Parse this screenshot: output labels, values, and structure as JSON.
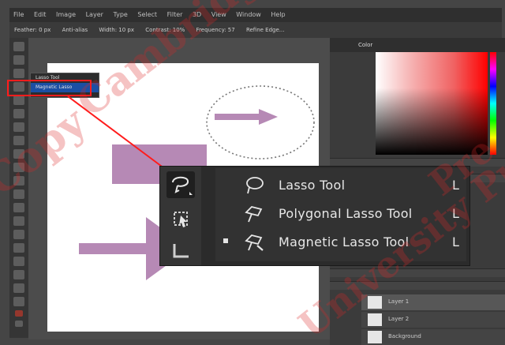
{
  "menubar": [
    "File",
    "Edit",
    "Image",
    "Layer",
    "Type",
    "Select",
    "Filter",
    "3D",
    "View",
    "Window",
    "Help"
  ],
  "options": [
    "Feather: 0 px",
    "Anti-alias",
    "Width: 10 px",
    "Contrast: 10%",
    "Frequency: 57",
    "Refine Edge..."
  ],
  "small_flyout": {
    "items": [
      "Lasso Tool",
      "Magnetic Lasso"
    ],
    "selected_index": 1
  },
  "panel": {
    "tab_label": "Color"
  },
  "flyout": {
    "items": [
      {
        "label": "Lasso Tool",
        "shortcut": "L",
        "icon": "lasso-icon",
        "selected": false
      },
      {
        "label": "Polygonal Lasso Tool",
        "shortcut": "L",
        "icon": "polygonal-lasso-icon",
        "selected": false
      },
      {
        "label": "Magnetic Lasso Tool",
        "shortcut": "L",
        "icon": "magnetic-lasso-icon",
        "selected": true
      }
    ]
  },
  "layers": [
    "Layer 1",
    "Layer 2",
    "Background"
  ],
  "watermark": [
    "Copy",
    "Cambridge",
    "University Press",
    "Pre"
  ],
  "colors": {
    "shape": "#b689b5",
    "highlight": "#ff1c1c",
    "ui_dark": "#2b2b2b",
    "selection_blue": "#1b4fa3"
  }
}
